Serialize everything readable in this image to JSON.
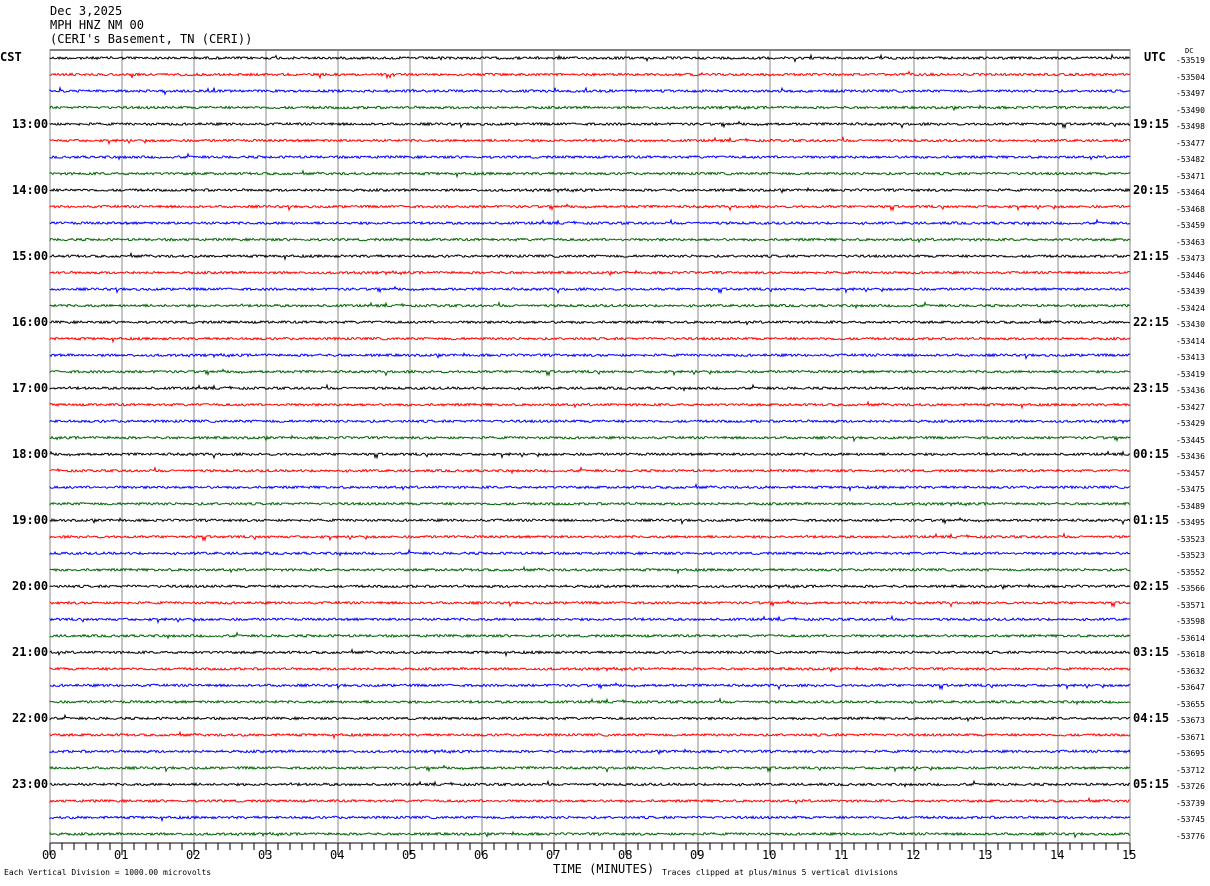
{
  "header": {
    "date": "Dec 3,2025",
    "station": "MPH HNZ NM 00",
    "location": "(CERI's Basement, TN (CERI))"
  },
  "left_axis_title": "CST",
  "right_axis_title": "UTC",
  "dc_title": "DC",
  "footer": {
    "scale_note": "Each Vertical Division = 1000.00 microvolts",
    "x_axis_title": "TIME (MINUTES)",
    "clip_note": "Traces clipped at plus/minus 5 vertical divisions"
  },
  "chart_data": {
    "type": "line",
    "title": "MPH HNZ NM 00",
    "xlabel": "TIME (MINUTES)",
    "xlim": [
      0,
      15
    ],
    "x_ticks": [
      "00",
      "01",
      "02",
      "03",
      "04",
      "05",
      "06",
      "07",
      "08",
      "09",
      "10",
      "11",
      "12",
      "13",
      "14",
      "15"
    ],
    "grid": true,
    "trace_colors": [
      "#000000",
      "#ff0000",
      "#0000ff",
      "#006400"
    ],
    "minutes_per_line": 15,
    "left_hour_labels": [
      "13:00",
      "14:00",
      "15:00",
      "16:00",
      "17:00",
      "18:00",
      "19:00",
      "20:00",
      "21:00",
      "22:00",
      "23:00"
    ],
    "right_hour_labels": [
      "19:15",
      "20:15",
      "21:15",
      "22:15",
      "23:15",
      "00:15",
      "01:15",
      "02:15",
      "03:15",
      "04:15",
      "05:15"
    ],
    "dc_offsets": [
      -53519,
      -53504,
      -53497,
      -53490,
      -53498,
      -53477,
      -53482,
      -53471,
      -53464,
      -53468,
      -53459,
      -53463,
      -53473,
      -53446,
      -53439,
      -53424,
      -53430,
      -53414,
      -53413,
      -53419,
      -53436,
      -53427,
      -53429,
      -53445,
      -53436,
      -53457,
      -53475,
      -53489,
      -53495,
      -53523,
      -53523,
      -53552,
      -53566,
      -53571,
      -53598,
      -53614,
      -53618,
      -53632,
      -53647,
      -53655,
      -53673,
      -53671,
      -53695,
      -53712,
      -53726,
      -53739,
      -53745,
      -53776
    ]
  }
}
